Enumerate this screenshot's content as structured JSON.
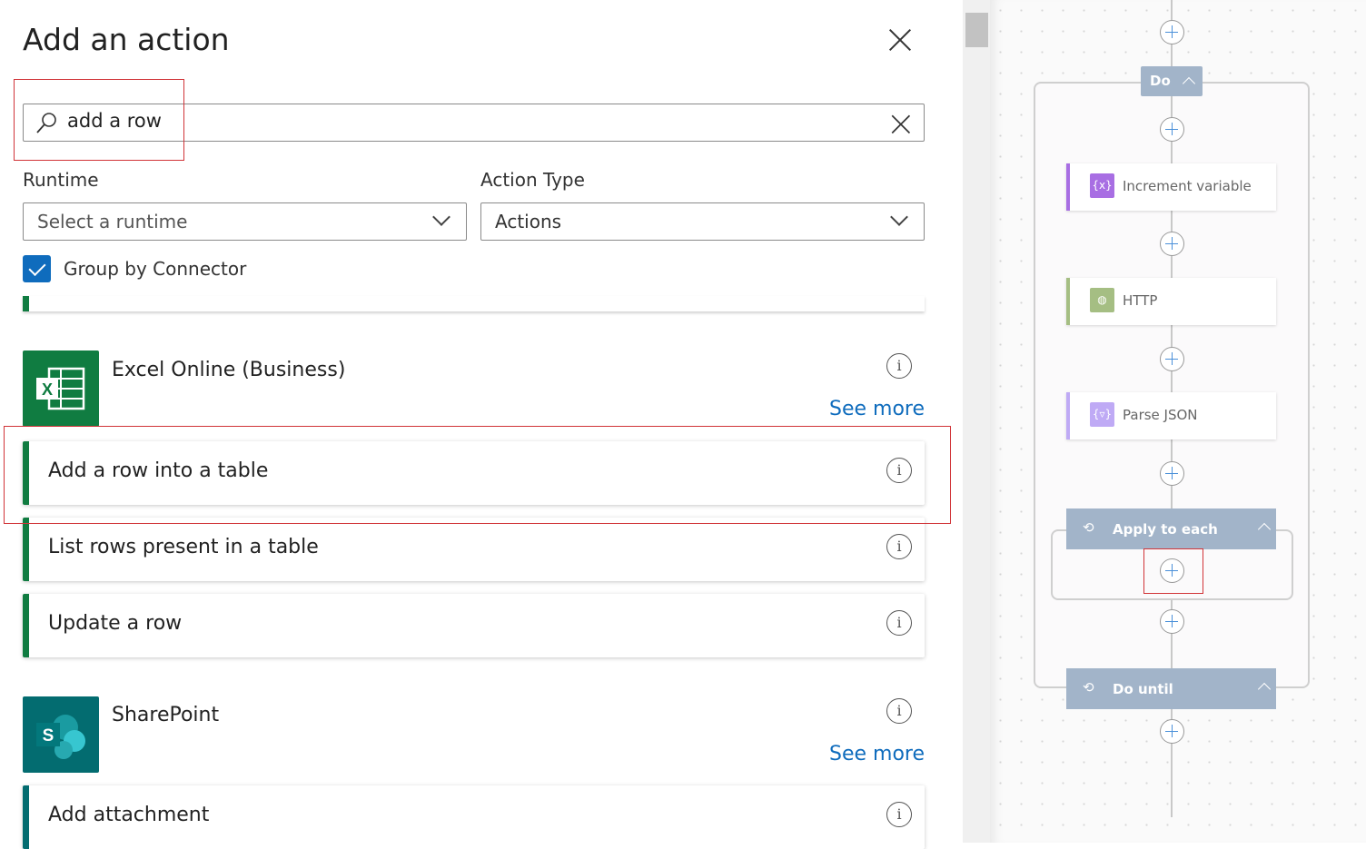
{
  "panel": {
    "title": "Add an action",
    "search_value": "add a row",
    "runtime_label": "Runtime",
    "runtime_value": "Select a runtime",
    "action_type_label": "Action Type",
    "action_type_value": "Actions",
    "group_by_label": "Group by Connector",
    "group_by_checked": true
  },
  "connectors": [
    {
      "name": "Excel Online (Business)",
      "see_more": "See more",
      "color": "#107c41",
      "actions": [
        "Add a row into a table",
        "List rows present in a table",
        "Update a row"
      ]
    },
    {
      "name": "SharePoint",
      "see_more": "See more",
      "color": "#036c70",
      "actions": [
        "Add attachment"
      ]
    }
  ],
  "flow": {
    "do_label": "Do",
    "nodes": [
      {
        "label": "Increment variable",
        "icon": "variable-icon",
        "color": "#a86ee3"
      },
      {
        "label": "HTTP",
        "icon": "globe-icon",
        "color": "#a5be83"
      },
      {
        "label": "Parse JSON",
        "icon": "data-operation-icon",
        "color": "#bfaaf5"
      }
    ],
    "apply_to_each": "Apply to each",
    "do_until": "Do until"
  },
  "colors": {
    "accent": "#0f6cbd",
    "highlight": "#d13438",
    "scope_header": "#a2b4c9"
  }
}
